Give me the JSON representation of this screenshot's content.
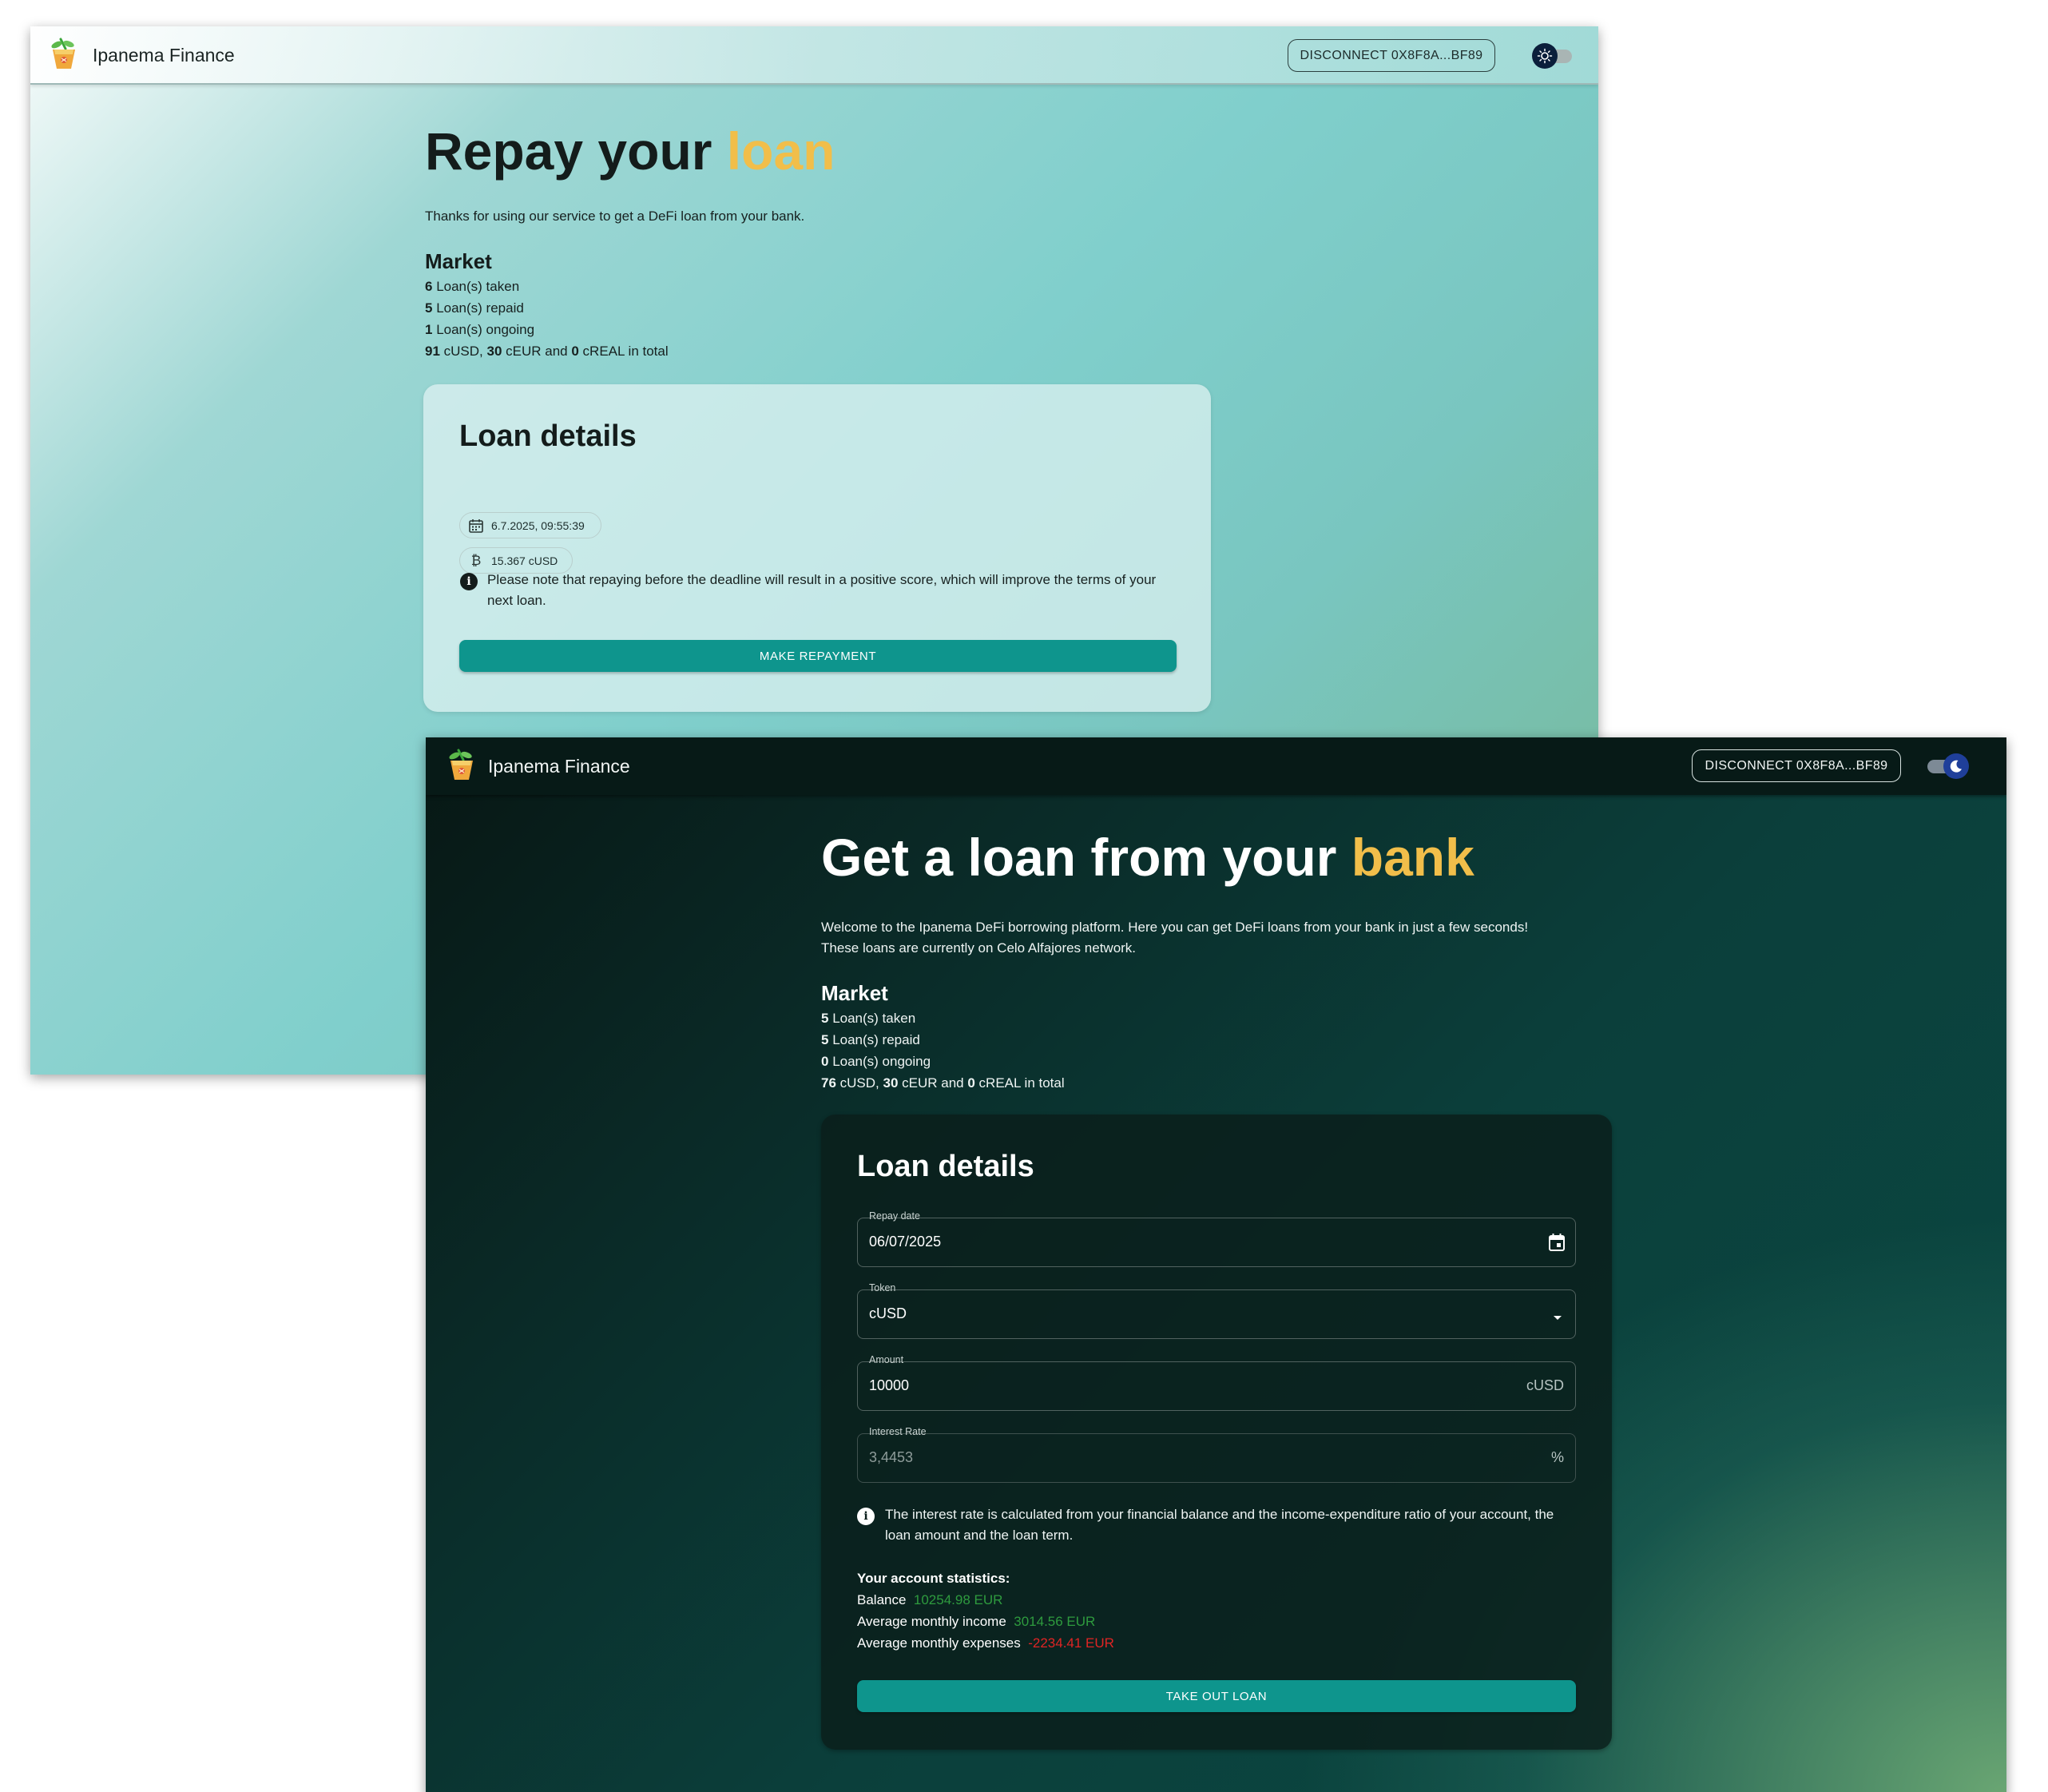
{
  "light": {
    "brand": "Ipanema Finance",
    "disconnect_label": "DISCONNECT 0X8F8A...BF89",
    "theme_toggle_state": "light",
    "title_main": "Repay your ",
    "title_accent": "loan",
    "intro": "Thanks for using our service to get a DeFi loan from your bank.",
    "market": {
      "title": "Market",
      "taken_count": "6",
      "taken_text": " Loan(s) taken",
      "repaid_count": "5",
      "repaid_text": " Loan(s) repaid",
      "ongoing_count": "1",
      "ongoing_text": " Loan(s) ongoing",
      "cusd": "91",
      "cusd_text": " cUSD, ",
      "ceur": "30",
      "ceur_text": " cEUR and ",
      "creal": "0",
      "creal_text": " cREAL in total"
    },
    "card": {
      "title": "Loan details",
      "date_chip": "6.7.2025, 09:55:39",
      "amount_chip": "15.367 cUSD",
      "note": "Please note that repaying before the deadline will result in a positive score, which will improve the terms of your next loan.",
      "button": "MAKE REPAYMENT"
    }
  },
  "dark": {
    "brand": "Ipanema Finance",
    "disconnect_label": "DISCONNECT 0X8F8A...BF89",
    "theme_toggle_state": "dark",
    "title_main": "Get a loan from your ",
    "title_accent": "bank",
    "intro_line1": "Welcome to the Ipanema DeFi borrowing platform. Here you can get DeFi loans from your bank in just a few seconds!",
    "intro_line2": "These loans are currently on Celo Alfajores network.",
    "market": {
      "title": "Market",
      "taken_count": "5",
      "taken_text": " Loan(s) taken",
      "repaid_count": "5",
      "repaid_text": " Loan(s) repaid",
      "ongoing_count": "0",
      "ongoing_text": " Loan(s) ongoing",
      "cusd": "76",
      "cusd_text": " cUSD, ",
      "ceur": "30",
      "ceur_text": " cEUR and ",
      "creal": "0",
      "creal_text": " cREAL in total"
    },
    "card": {
      "title": "Loan details",
      "repay_date_label": "Repay date",
      "repay_date_value": "06/07/2025",
      "token_label": "Token",
      "token_value": "cUSD",
      "amount_label": "Amount",
      "amount_value": "10000",
      "amount_suffix": "cUSD",
      "interest_label": "Interest Rate",
      "interest_value": "3,4453",
      "interest_suffix": "%",
      "note": "The interest rate is calculated from your financial balance and the income-expenditure ratio of your account, the loan amount and the loan term.",
      "stats_title": "Your account statistics:",
      "balance_label": "Balance",
      "balance_value": "10254.98 EUR",
      "income_label": "Average monthly income",
      "income_value": "3014.56 EUR",
      "expenses_label": "Average monthly expenses",
      "expenses_value": "-2234.41 EUR",
      "button": "TAKE OUT LOAN"
    }
  },
  "colors": {
    "accent_yellow": "#f1be4a",
    "button_teal": "#0e958d",
    "positive_green": "#2e9b3e",
    "negative_red": "#e02424"
  },
  "icons": [
    "cocktail-logo-icon",
    "sun-icon",
    "moon-icon",
    "calendar-icon",
    "bitcoin-icon",
    "info-icon",
    "dropdown-arrow-icon"
  ]
}
